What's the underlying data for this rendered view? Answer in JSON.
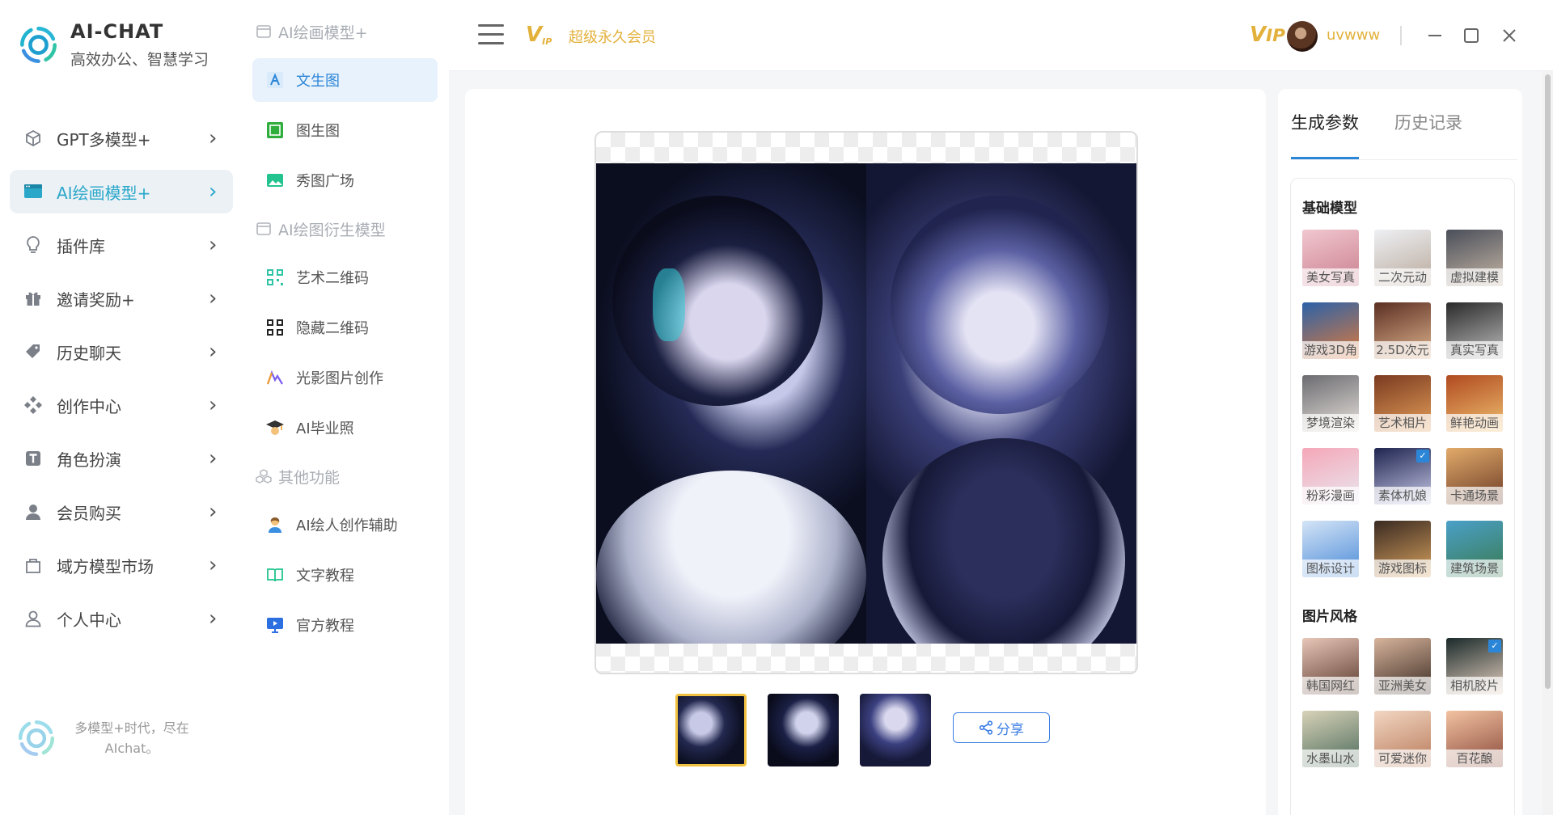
{
  "brand": {
    "name": "AI-CHAT",
    "slogan": "高效办公、智慧学习"
  },
  "sidebar": {
    "items": [
      {
        "label": "GPT多模型+",
        "icon": "cube-icon"
      },
      {
        "label": "AI绘画模型+",
        "icon": "monitor-icon",
        "active": true
      },
      {
        "label": "插件库",
        "icon": "lightbulb-icon"
      },
      {
        "label": "邀请奖励+",
        "icon": "gift-icon"
      },
      {
        "label": "历史聊天",
        "icon": "tag-icon"
      },
      {
        "label": "创作中心",
        "icon": "grid-icon"
      },
      {
        "label": "角色扮演",
        "icon": "t-box-icon"
      },
      {
        "label": "会员购买",
        "icon": "user-filled-icon"
      },
      {
        "label": "域方模型市场",
        "icon": "bag-icon"
      },
      {
        "label": "个人中心",
        "icon": "user-icon"
      }
    ],
    "footer_text": "多模型+时代，尽在AIchat。"
  },
  "submenu": {
    "group1_title": "AI绘画模型+",
    "group1": [
      "文生图",
      "图生图",
      "秀图广场"
    ],
    "group2_title": "AI绘图衍生模型",
    "group2": [
      "艺术二维码",
      "隐藏二维码",
      "光影图片创作",
      "AI毕业照"
    ],
    "group3_title": "其他功能",
    "group3": [
      "AI绘人创作辅助",
      "文字教程",
      "官方教程"
    ]
  },
  "topbar": {
    "vip_label": "超级永久会员",
    "vip_badge": "V",
    "vip_badge_sub": "IP",
    "username": "uvwww"
  },
  "main": {
    "share_label": "分享",
    "thumbnail_count": 3,
    "selected_thumbnail": 1
  },
  "rpanel": {
    "tabs": [
      "生成参数",
      "历史记录"
    ],
    "active_tab": 0,
    "base_title": "基础模型",
    "base_models": [
      {
        "label": "美女写真",
        "selected": false
      },
      {
        "label": "二次元动",
        "selected": false
      },
      {
        "label": "虚拟建模",
        "selected": false
      },
      {
        "label": "游戏3D角",
        "selected": false
      },
      {
        "label": "2.5D次元",
        "selected": false
      },
      {
        "label": "真实写真",
        "selected": false
      },
      {
        "label": "梦境渲染",
        "selected": false
      },
      {
        "label": "艺术相片",
        "selected": false
      },
      {
        "label": "鲜艳动画",
        "selected": false
      },
      {
        "label": "粉彩漫画",
        "selected": false
      },
      {
        "label": "素体机娘",
        "selected": true
      },
      {
        "label": "卡通场景",
        "selected": false
      },
      {
        "label": "图标设计",
        "selected": false
      },
      {
        "label": "游戏图标",
        "selected": false
      },
      {
        "label": "建筑场景",
        "selected": false
      }
    ],
    "style_title": "图片风格",
    "styles": [
      {
        "label": "韩国网红",
        "selected": false
      },
      {
        "label": "亚洲美女",
        "selected": false
      },
      {
        "label": "相机胶片",
        "selected": true
      },
      {
        "label": "水墨山水",
        "selected": false
      },
      {
        "label": "可爱迷你",
        "selected": false
      },
      {
        "label": "百花酿",
        "selected": false
      }
    ]
  },
  "colors": {
    "accent": "#2aa7c9",
    "link": "#2c86d8",
    "vip": "#e3b13b"
  }
}
